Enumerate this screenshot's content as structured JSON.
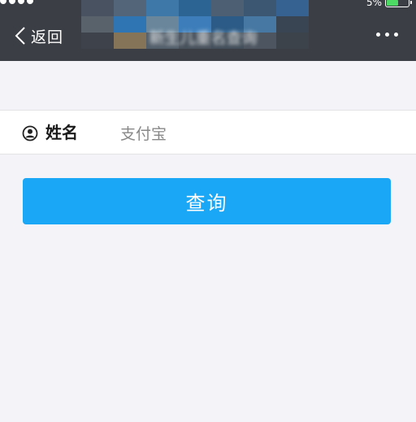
{
  "status_bar": {
    "battery_text": "5%"
  },
  "nav": {
    "back_label": "返回",
    "title": "新生儿重名查询",
    "more_icon": "more-dots-icon",
    "back_icon": "chevron-left-icon"
  },
  "form": {
    "name_label": "姓名",
    "name_value": "支付宝",
    "name_icon": "user-circle-icon"
  },
  "actions": {
    "query_label": "查询"
  },
  "colors": {
    "header_bg": "#3b3e45",
    "page_bg": "#f4f3f7",
    "button_bg": "#1aa7f5",
    "battery_fill": "#4cd964"
  }
}
